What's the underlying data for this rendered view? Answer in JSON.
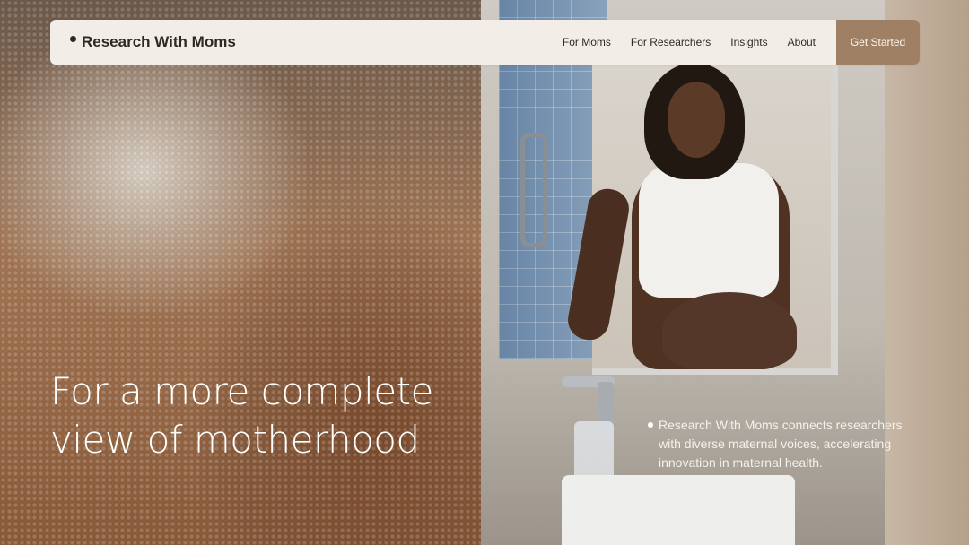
{
  "nav": {
    "brand": "Research With Moms",
    "links": [
      "For Moms",
      "For Researchers",
      "Insights",
      "About"
    ],
    "cta": "Get Started"
  },
  "hero": {
    "headline": "For a more complete view of motherhood",
    "description": "Research With Moms connects researchers with diverse maternal voices, accelerating innovation in maternal health."
  },
  "colors": {
    "nav_background": "#f2eee7",
    "cta_background": "#a08064",
    "text_dark": "#2c2a27",
    "text_light": "#ffffff"
  }
}
